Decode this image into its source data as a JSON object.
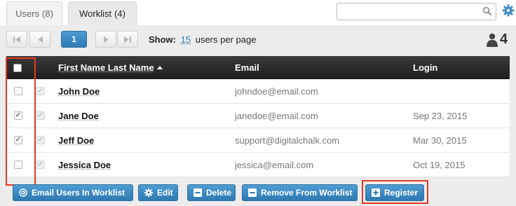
{
  "tabs": [
    {
      "label": "Users",
      "count": "(8)"
    },
    {
      "label": "Worklist",
      "count": "(4)"
    }
  ],
  "search": {
    "placeholder": ""
  },
  "pager": {
    "current_page": "1"
  },
  "show": {
    "prefix": "Show:",
    "value": "15",
    "suffix": "users per page"
  },
  "user_count": "4",
  "table": {
    "columns": [
      "First Name Last Name",
      "Email",
      "Login"
    ],
    "rows": [
      {
        "name": "John Doe",
        "email": "johndoe@email.com",
        "login": "",
        "checked": false
      },
      {
        "name": "Jane Doe",
        "email": "janedoe@email.com",
        "login": "Sep 23, 2015",
        "checked": true
      },
      {
        "name": "Jeff Doe",
        "email": "support@digitalchalk.com",
        "login": "Mar 30, 2015",
        "checked": true
      },
      {
        "name": "Jessica Doe",
        "email": "jessica@email.com",
        "login": "Oct 19, 2015",
        "checked": false
      }
    ]
  },
  "actions": {
    "email": "Email Users In Worklist",
    "edit": "Edit",
    "delete": "Delete",
    "remove": "Remove From Worklist",
    "register": "Register"
  },
  "colors": {
    "accent": "#2f7bb4",
    "header": "#1e1e1e",
    "highlight": "#e23a22"
  }
}
